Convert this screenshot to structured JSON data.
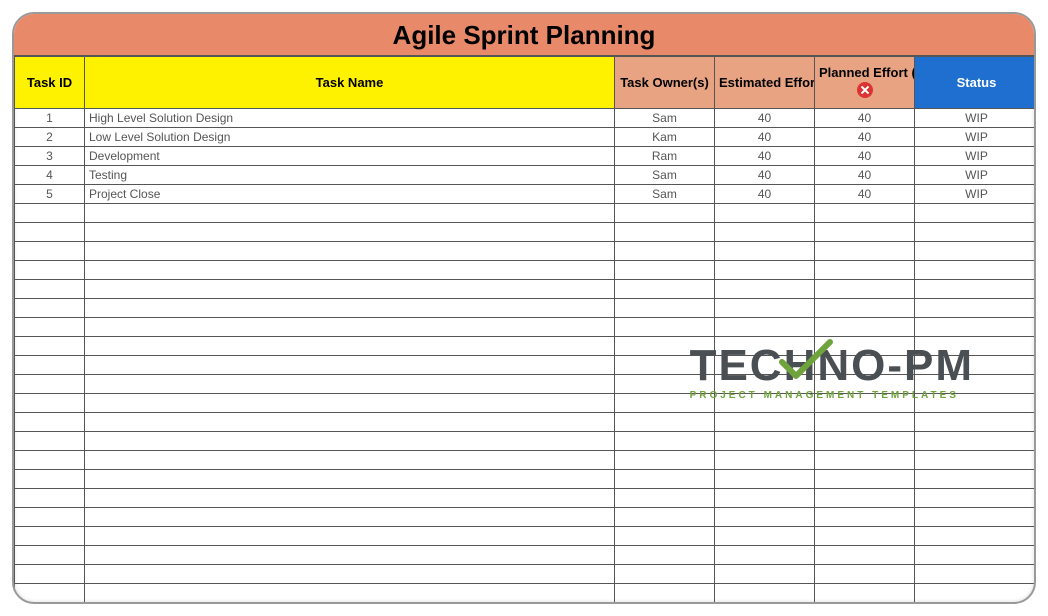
{
  "title": "Agile Sprint Planning",
  "columns": {
    "id": "Task ID",
    "name": "Task Name",
    "owner": "Task Owner(s)",
    "estimated": "Estimated Effort (hrs)",
    "planned": "Planned Effort (hrs)",
    "status": "Status"
  },
  "rows": [
    {
      "id": "1",
      "name": "High Level Solution Design",
      "owner": "Sam",
      "estimated": "40",
      "planned": "40",
      "status": "WIP"
    },
    {
      "id": "2",
      "name": "Low Level Solution Design",
      "owner": "Kam",
      "estimated": "40",
      "planned": "40",
      "status": "WIP"
    },
    {
      "id": "3",
      "name": "Development",
      "owner": "Ram",
      "estimated": "40",
      "planned": "40",
      "status": "WIP"
    },
    {
      "id": "4",
      "name": "Testing",
      "owner": "Sam",
      "estimated": "40",
      "planned": "40",
      "status": "WIP"
    },
    {
      "id": "5",
      "name": "Project Close",
      "owner": "Sam",
      "estimated": "40",
      "planned": "40",
      "status": "WIP"
    }
  ],
  "empty_row_count": 22,
  "watermark": {
    "brand": "TECHNO-PM",
    "tagline": "PROJECT MANAGEMENT TEMPLATES"
  }
}
